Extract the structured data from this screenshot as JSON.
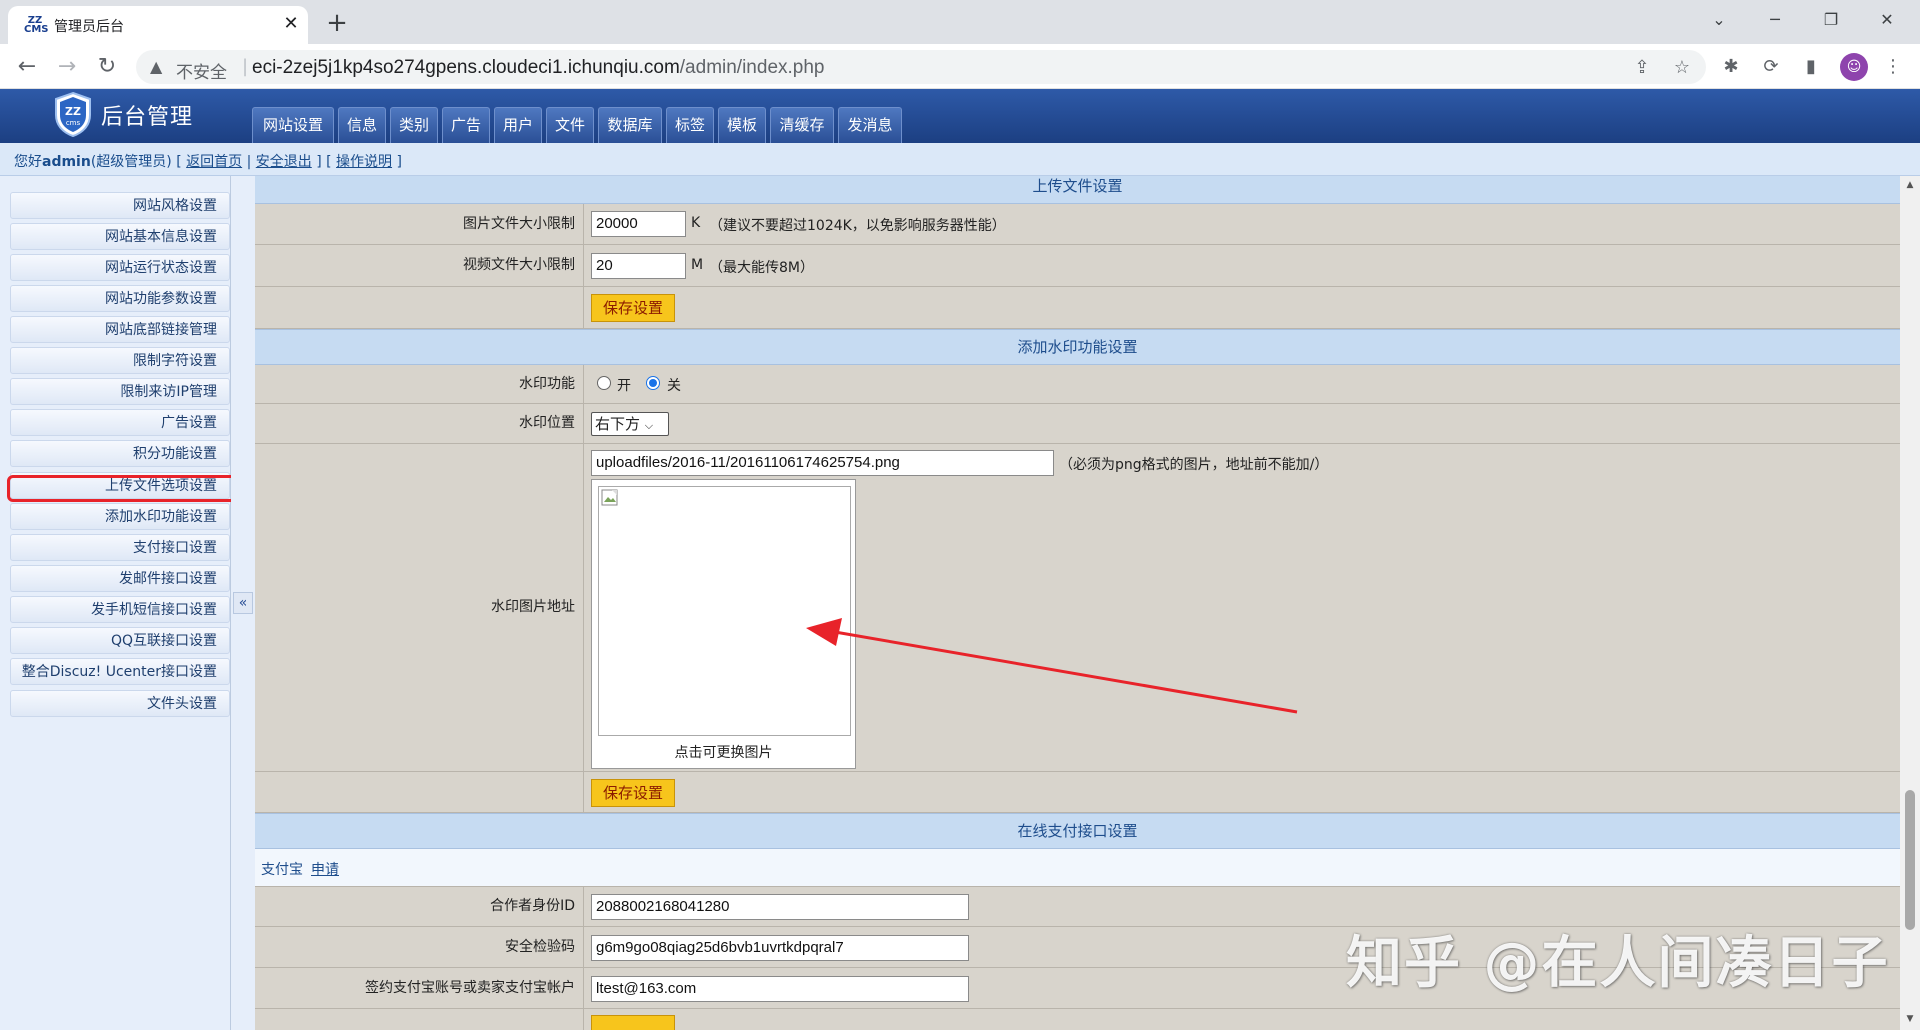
{
  "browser": {
    "tab_favicon": "ZZ CMS",
    "tab_title": "管理员后台",
    "new_tab": "+",
    "insecure_label": "不安全",
    "url_host": "eci-2zej5j1kp4so274gpens.cloudeci1.ichunqiu.com",
    "url_path": "/admin/index.php"
  },
  "header": {
    "logo_text": "后台管理",
    "menu": [
      "网站设置",
      "信息",
      "类别",
      "广告",
      "用户",
      "文件",
      "数据库",
      "标签",
      "模板",
      "清缓存",
      "发消息"
    ]
  },
  "userbar": {
    "greeting_prefix": "您好",
    "username": "admin",
    "role": "(超级管理员)",
    "links": [
      "返回首页",
      "安全退出",
      "操作说明"
    ]
  },
  "sidebar": {
    "items": [
      "网站风格设置",
      "网站基本信息设置",
      "网站运行状态设置",
      "网站功能参数设置",
      "网站底部链接管理",
      "限制字符设置",
      "限制来访IP管理",
      "广告设置",
      "积分功能设置",
      "上传文件选项设置",
      "添加水印功能设置",
      "支付接口设置",
      "发邮件接口设置",
      "发手机短信接口设置",
      "QQ互联接口设置",
      "整合Discuz! Ucenter接口设置",
      "文件头设置"
    ],
    "toggle": "«",
    "highlighted_index": 9
  },
  "upload": {
    "title": "上传文件设置",
    "img_label": "图片文件大小限制",
    "img_value": "20000",
    "img_unit": "K",
    "img_hint": "（建议不要超过1024K，以免影响服务器性能）",
    "video_label": "视频文件大小限制",
    "video_value": "20",
    "video_unit": "M",
    "video_hint": "（最大能传8M）",
    "save": "保存设置"
  },
  "watermark": {
    "title": "添加水印功能设置",
    "func_label": "水印功能",
    "opt_on": "开",
    "opt_off": "关",
    "pos_label": "水印位置",
    "pos_value": "右下方",
    "img_label": "水印图片地址",
    "img_path": "uploadfiles/2016-11/20161106174625754.png",
    "img_hint": "（必须为png格式的图片，地址前不能加/）",
    "preview_caption": "点击可更换图片",
    "save": "保存设置"
  },
  "payment": {
    "title": "在线支付接口设置",
    "provider": "支付宝",
    "apply": "申请",
    "partner_label": "合作者身份ID",
    "partner_value": "2088002168041280",
    "key_label": "安全检验码",
    "key_value": "g6m9go08qiag25d6bvb1uvrtkdpqral7",
    "account_label": "签约支付宝账号或卖家支付宝帐户",
    "account_value": "ltest@163.com"
  },
  "overlay_watermark": "知乎 @在人间凑日子",
  "colors": {
    "header_blue": "#1c3f82",
    "section_blue": "#c6dbf2",
    "save_yellow": "#f7c51c",
    "highlight_red": "#e8232a"
  }
}
